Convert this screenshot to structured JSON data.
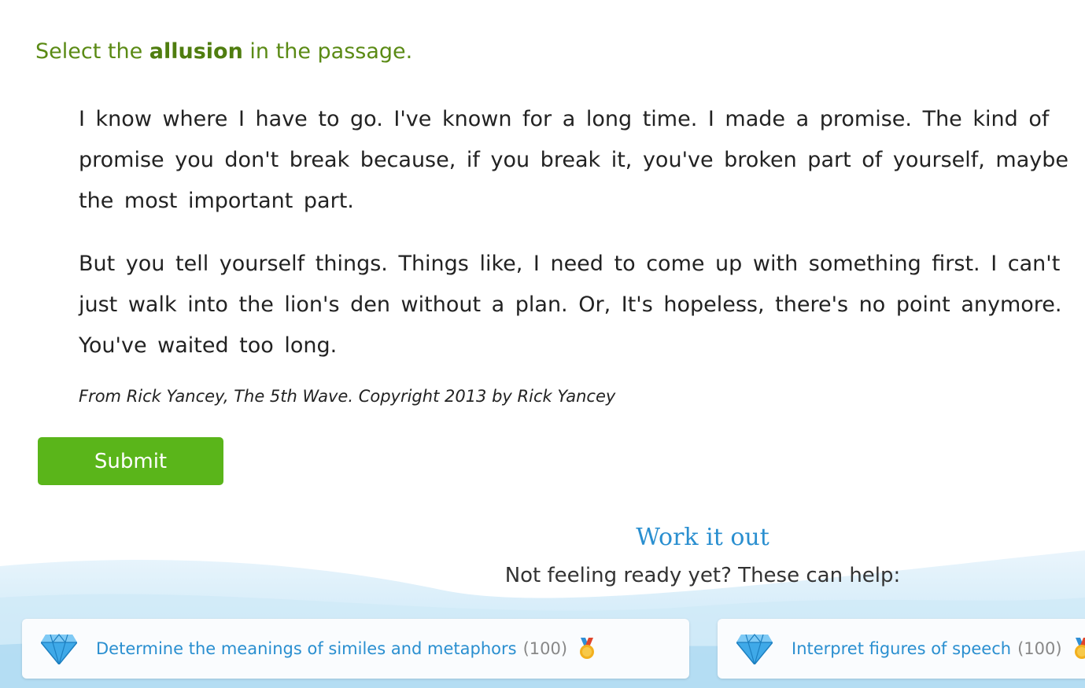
{
  "question": {
    "prompt_prefix": "Select the ",
    "prompt_bold": "allusion",
    "prompt_suffix": " in the passage."
  },
  "passage": {
    "paragraphs": [
      [
        "I know where I have to go.",
        " ",
        "I've known for a long time.",
        " ",
        "I made a promise.",
        " ",
        "The kind of promise you don't break because, if you break it, you've broken part of yourself, maybe the most important part."
      ],
      [
        "But you tell yourself things.",
        " ",
        "Things like, I need to come up with something first.",
        " ",
        "I can't just walk into the lion's den without a plan.",
        " ",
        "Or, It's hopeless, there's no point anymore.",
        " ",
        "You've waited too long."
      ]
    ],
    "source": "From Rick Yancey, The 5th Wave. Copyright 2013 by Rick Yancey"
  },
  "submit_label": "Submit",
  "help": {
    "title": "Work it out",
    "subtitle": "Not feeling ready yet? These can help:",
    "cards": [
      {
        "label": "Determine the meanings of similes and metaphors",
        "count": "(100)"
      },
      {
        "label": "Interpret figures of speech",
        "count": "(100)"
      }
    ]
  },
  "icons": {
    "gem": "diamond-icon",
    "medal": "medal-icon"
  },
  "colors": {
    "prompt": "#5a8a14",
    "submit": "#5ab51a",
    "link": "#2a8fd0",
    "gem": "#3fa9e8",
    "medal": "#f2b01e"
  }
}
